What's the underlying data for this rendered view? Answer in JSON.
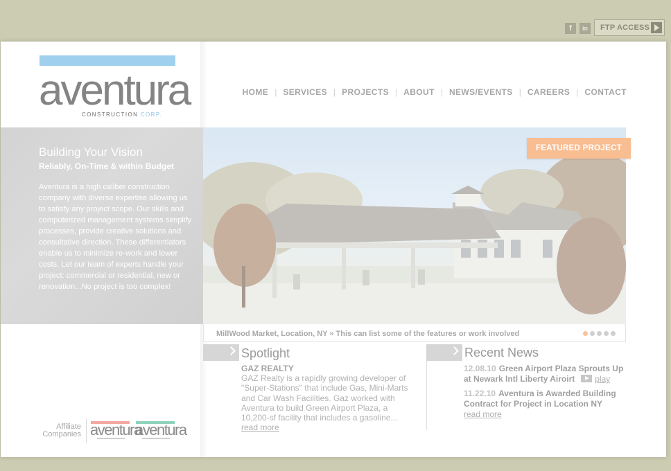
{
  "topbar": {
    "social": [
      {
        "name": "facebook",
        "glyph": "f"
      },
      {
        "name": "linkedin",
        "glyph": "in"
      }
    ],
    "ftp_label": "FTP ACCESS"
  },
  "logo": {
    "word": "aventura",
    "sub_main": "CONSTRUCTION",
    "sub_accent": "CORP."
  },
  "nav": [
    "HOME",
    "SERVICES",
    "PROJECTS",
    "ABOUT",
    "NEWS/EVENTS",
    "CAREERS",
    "CONTACT"
  ],
  "intro": {
    "title": "Building Your Vision",
    "subtitle": "Reliably, On-Time & within Budget",
    "body": "Aventura is a high caliber construction company with diverse expertise allowing us to satisfy any project scope. Our skills and computerized management systems simplify processes, provide creative solutions and consultative direction. These differentiators enable us to minimize re-work and lower costs. Let our team of experts handle your project: commercial or residential, new or renovation...No project is too complex!"
  },
  "featured": {
    "badge": "FEATURED PROJECT",
    "caption": "MillWood Market, Location, NY » This can list some of the features or work involved",
    "slides": 5,
    "active_slide": 1
  },
  "spotlight": {
    "title": "Spotlight",
    "name": "GAZ REALTY",
    "body": "GAZ Realty is a rapidly growing developer of \"Super-Stations\" that include Gas, Mini-Marts and Car Wash Facilities. Gaz worked with Aventura to build Green Airport Plaza, a 10,200-sf facility that includes a gasoline...",
    "read_more": "read more"
  },
  "news": {
    "title": "Recent News",
    "items": [
      {
        "date": "12.08.10",
        "text": "Green Airport Plaza Sprouts Up at Newark Intl Liberty Airoirt",
        "link": "play"
      },
      {
        "date": "11.22.10",
        "text": "Aventura is Awarded Building Contract for Project in Location NY",
        "link": "read more"
      }
    ]
  },
  "affiliates": {
    "label_line1": "Affiliate",
    "label_line2": "Companies",
    "logos": [
      {
        "word": "aventura",
        "bar_color": "#f3a8a0"
      },
      {
        "word": "aventura",
        "bar_color": "#8fd3bb"
      }
    ]
  },
  "colors": {
    "outer_bg": "#ccccb2",
    "logo_bar": "#9fd0ee",
    "featured_badge": "#f9bd92"
  }
}
